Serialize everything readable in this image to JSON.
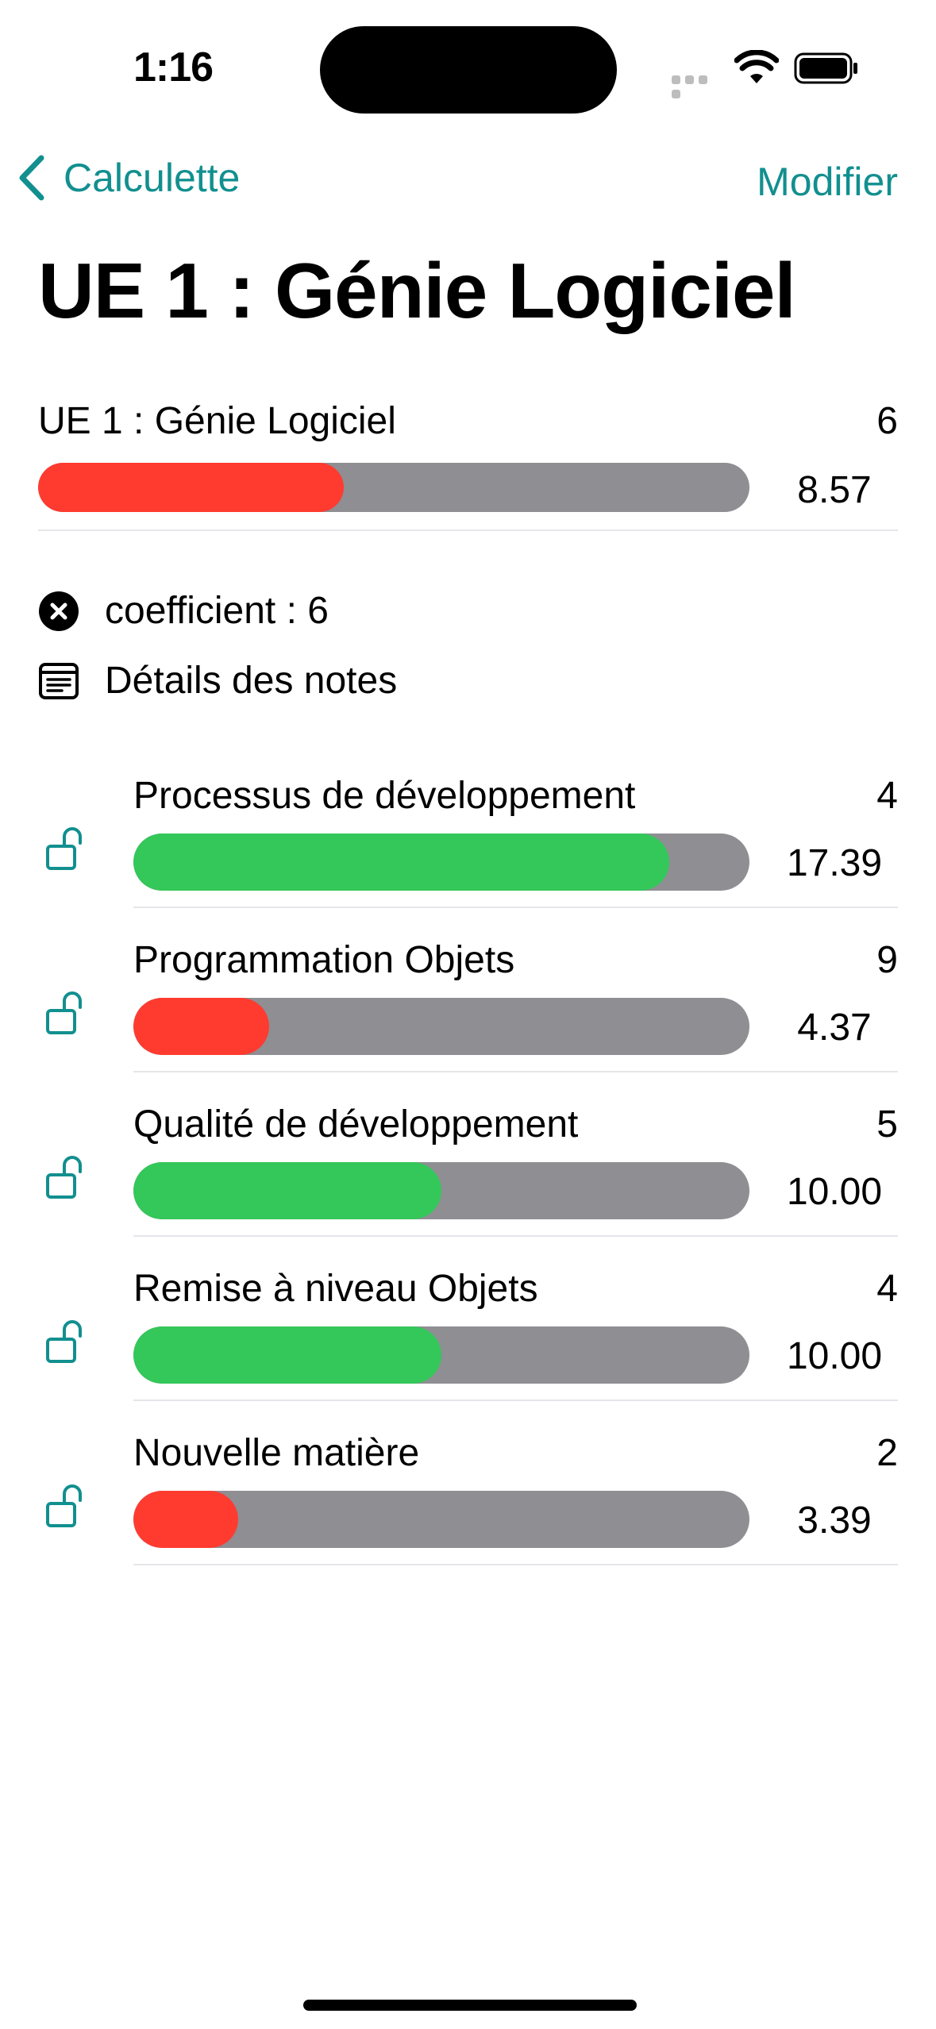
{
  "status_bar": {
    "time": "1:16"
  },
  "nav": {
    "back_label": "Calculette",
    "edit_label": "Modifier"
  },
  "page": {
    "title": "UE 1 : Génie Logiciel"
  },
  "summary": {
    "label": "UE 1 : Génie Logiciel",
    "coefficient": "6",
    "value": "8.57",
    "fill_ratio": 0.43,
    "color": "#ff3b30"
  },
  "info": {
    "coefficient_text": "coefficient : 6",
    "details_text": "Détails des notes"
  },
  "subjects": [
    {
      "label": "Processus de développement",
      "coefficient": "4",
      "value": "17.39",
      "fill_ratio": 0.87,
      "color": "#34c759"
    },
    {
      "label": "Programmation Objets",
      "coefficient": "9",
      "value": "4.37",
      "fill_ratio": 0.22,
      "color": "#ff3b30"
    },
    {
      "label": "Qualité de développement",
      "coefficient": "5",
      "value": "10.00",
      "fill_ratio": 0.5,
      "color": "#34c759"
    },
    {
      "label": "Remise à niveau Objets",
      "coefficient": "4",
      "value": "10.00",
      "fill_ratio": 0.5,
      "color": "#34c759"
    },
    {
      "label": "Nouvelle matière",
      "coefficient": "2",
      "value": "3.39",
      "fill_ratio": 0.17,
      "color": "#ff3b30"
    }
  ],
  "colors": {
    "accent": "#128f8f",
    "track": "#8e8e93",
    "good": "#34c759",
    "bad": "#ff3b30"
  }
}
